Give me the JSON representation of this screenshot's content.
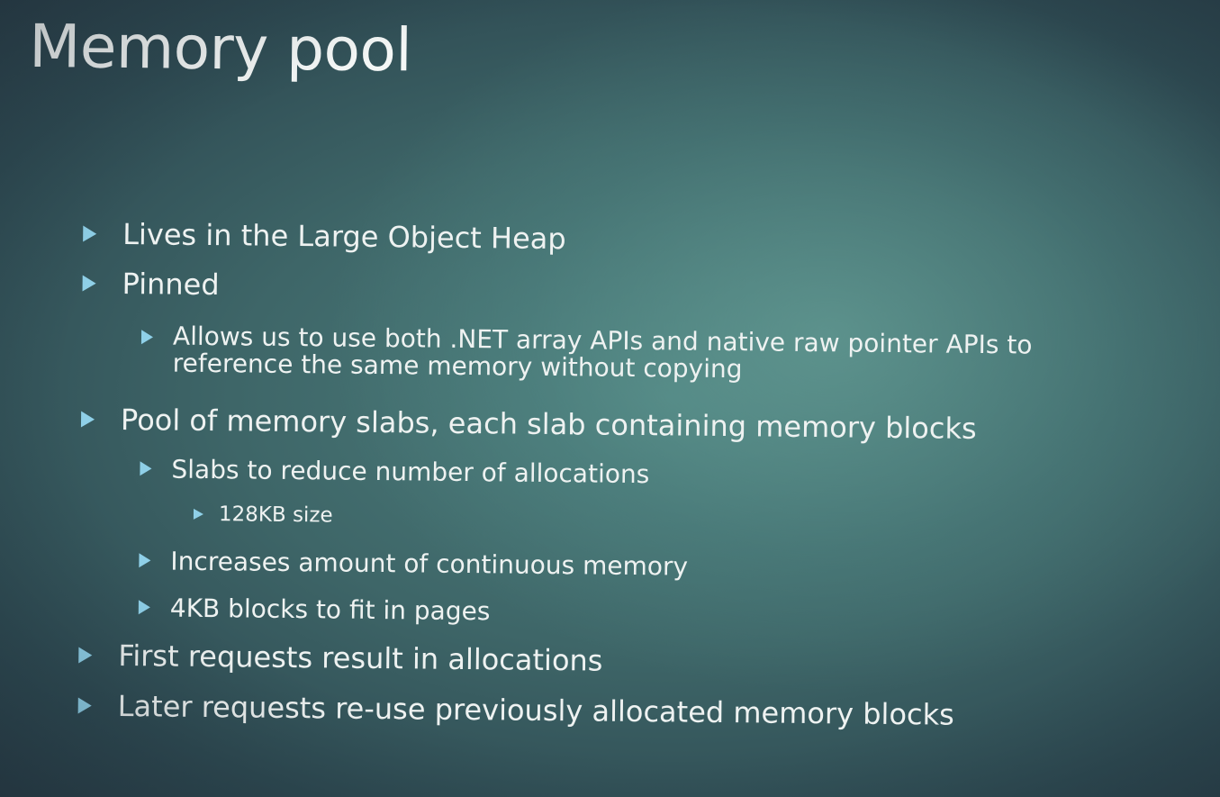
{
  "slide": {
    "title": "Memory pool",
    "bullets": [
      {
        "level": 1,
        "text": "Lives in the Large Object Heap"
      },
      {
        "level": 1,
        "text": "Pinned"
      },
      {
        "level": 2,
        "line1": "Allows us to use both .NET array APIs and native raw pointer APIs to",
        "line2": "reference the same memory without copying"
      },
      {
        "level": 1,
        "text": "Pool of memory slabs, each slab containing memory blocks"
      },
      {
        "level": 2,
        "text": "Slabs to reduce number of allocations"
      },
      {
        "level": 3,
        "text": "128KB size"
      },
      {
        "level": 2,
        "text": "Increases amount of continuous memory"
      },
      {
        "level": 2,
        "text": "4KB blocks to fit in pages"
      },
      {
        "level": 1,
        "text": "First requests result in allocations"
      },
      {
        "level": 1,
        "text": "Later requests re-use previously allocated memory blocks"
      }
    ]
  },
  "colors": {
    "bullet_arrow": "#8fd0e8",
    "text": "#eef2f1",
    "background_center": "#4d7f7d",
    "background_edge": "#2a3f49"
  },
  "icons": {
    "bullet": "triangle-right-icon"
  }
}
